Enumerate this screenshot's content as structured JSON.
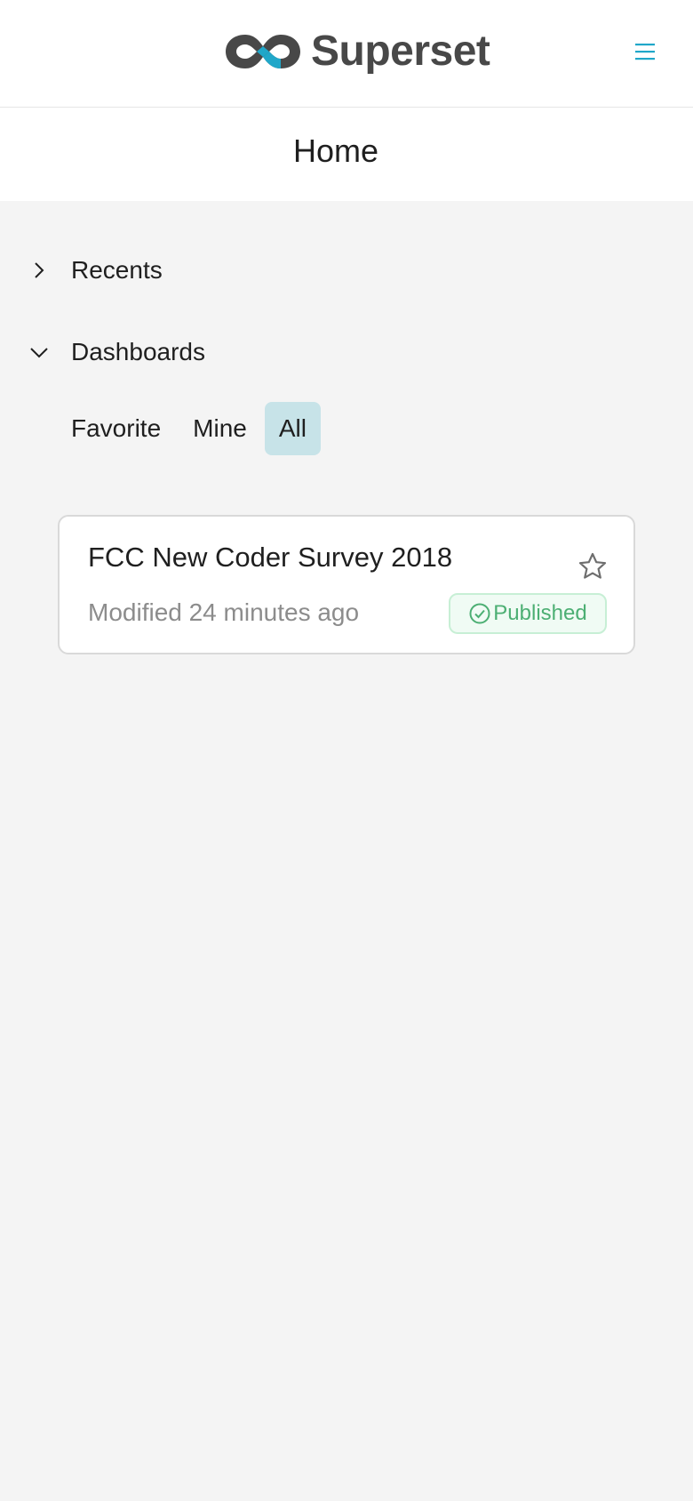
{
  "header": {
    "brand": "Superset",
    "menu_icon": "hamburger-menu-icon",
    "brand_colors": {
      "dark": "#484848",
      "accent": "#20a7c9"
    }
  },
  "page": {
    "title": "Home"
  },
  "sections": {
    "recents": {
      "label": "Recents",
      "expanded": false
    },
    "dashboards": {
      "label": "Dashboards",
      "expanded": true,
      "tabs": [
        {
          "label": "Favorite",
          "active": false
        },
        {
          "label": "Mine",
          "active": false
        },
        {
          "label": "All",
          "active": true
        }
      ]
    }
  },
  "dashboards": [
    {
      "title": "FCC New Coder Survey 2018",
      "modified": "Modified 24 minutes ago",
      "status": "Published",
      "favorite": false
    }
  ],
  "colors": {
    "active_tab_bg": "#c7e3e8",
    "published_green": "#4caf73",
    "background": "#f4f4f4"
  }
}
